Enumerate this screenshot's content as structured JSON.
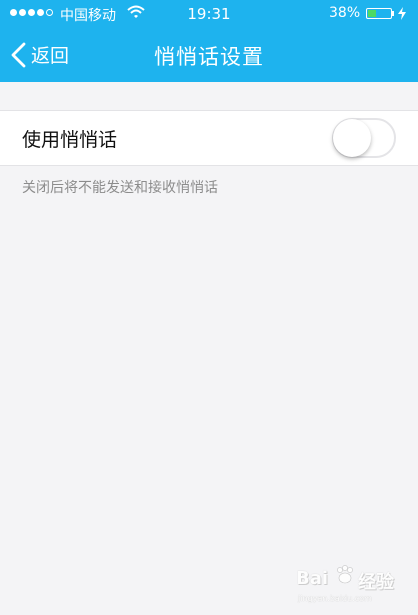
{
  "status_bar": {
    "carrier": "中国移动",
    "time": "19:31",
    "battery_percent": "38%",
    "battery_level": 0.38,
    "icons": [
      "signal-dots",
      "wifi-icon",
      "battery-icon",
      "charging-bolt-icon"
    ]
  },
  "nav": {
    "back_label": "返回",
    "title": "悄悄话设置",
    "background_color": "#1eb3ee"
  },
  "settings": {
    "row_label": "使用悄悄话",
    "toggle_on": false,
    "hint": "关闭后将不能发送和接收悄悄话"
  },
  "watermark": {
    "brand_left": "Bai",
    "brand_right": "经验",
    "url": "jingyan.baidu.com"
  }
}
